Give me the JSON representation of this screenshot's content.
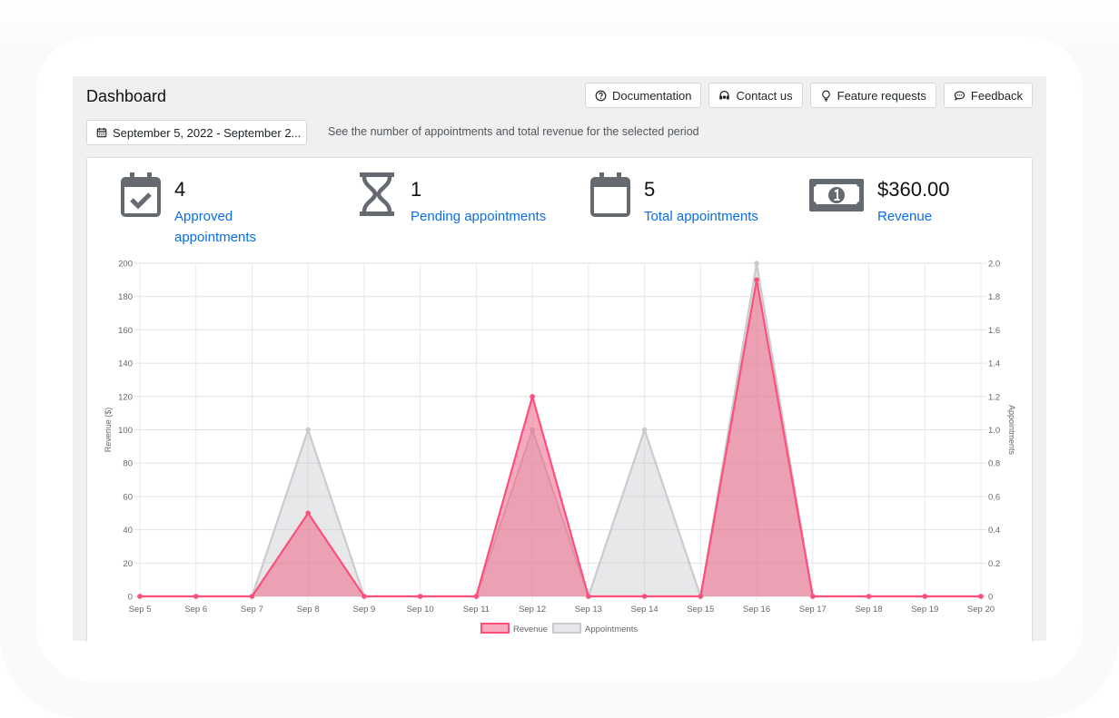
{
  "header": {
    "title": "Dashboard",
    "buttons": [
      {
        "label": "Documentation",
        "icon": "question-circle-icon"
      },
      {
        "label": "Contact us",
        "icon": "headset-icon"
      },
      {
        "label": "Feature requests",
        "icon": "lightbulb-icon"
      },
      {
        "label": "Feedback",
        "icon": "chat-bubble-icon"
      }
    ]
  },
  "filters": {
    "date_range": "September 5, 2022 - September 2...",
    "date_icon": "calendar-icon",
    "description": "See the number of appointments and total revenue for the selected period"
  },
  "stats": [
    {
      "value": "4",
      "label": "Approved appointments",
      "icon": "calendar-check-icon"
    },
    {
      "value": "1",
      "label": "Pending appointments",
      "icon": "hourglass-icon"
    },
    {
      "value": "5",
      "label": "Total appointments",
      "icon": "calendar-icon"
    },
    {
      "value": "$360.00",
      "label": "Revenue",
      "icon": "money-bill-icon"
    }
  ],
  "colors": {
    "revenue_line": "#ff4f7b",
    "revenue_fill": "rgba(240,100,135,0.55)",
    "appointments_line": "#c9cbcf",
    "appointments_fill": "rgba(201,203,207,0.45)",
    "link": "#0a6ee6"
  },
  "chart_data": {
    "type": "area",
    "categories": [
      "Sep 5",
      "Sep 6",
      "Sep 7",
      "Sep 8",
      "Sep 9",
      "Sep 10",
      "Sep 11",
      "Sep 12",
      "Sep 13",
      "Sep 14",
      "Sep 15",
      "Sep 16",
      "Sep 17",
      "Sep 18",
      "Sep 19",
      "Sep 20"
    ],
    "series": [
      {
        "name": "Revenue",
        "axis": "left",
        "values": [
          0,
          0,
          0,
          50,
          0,
          0,
          0,
          120,
          0,
          0,
          0,
          190,
          0,
          0,
          0,
          0
        ]
      },
      {
        "name": "Appointments",
        "axis": "right",
        "values": [
          0,
          0,
          0,
          1,
          0,
          0,
          0,
          1,
          0,
          1,
          0,
          2,
          0,
          0,
          0,
          0
        ]
      }
    ],
    "ylabel": "Revenue ($)",
    "y2label": "Appointments",
    "ylim": [
      0,
      200
    ],
    "y2lim": [
      0,
      2.0
    ],
    "yticks": [
      "0",
      "20",
      "40",
      "60",
      "80",
      "100",
      "120",
      "140",
      "160",
      "180",
      "200"
    ],
    "y2ticks": [
      "0",
      "0.2",
      "0.4",
      "0.6",
      "0.8",
      "1.0",
      "1.2",
      "1.4",
      "1.6",
      "1.8",
      "2.0"
    ],
    "grid": true,
    "legend": "bottom"
  }
}
